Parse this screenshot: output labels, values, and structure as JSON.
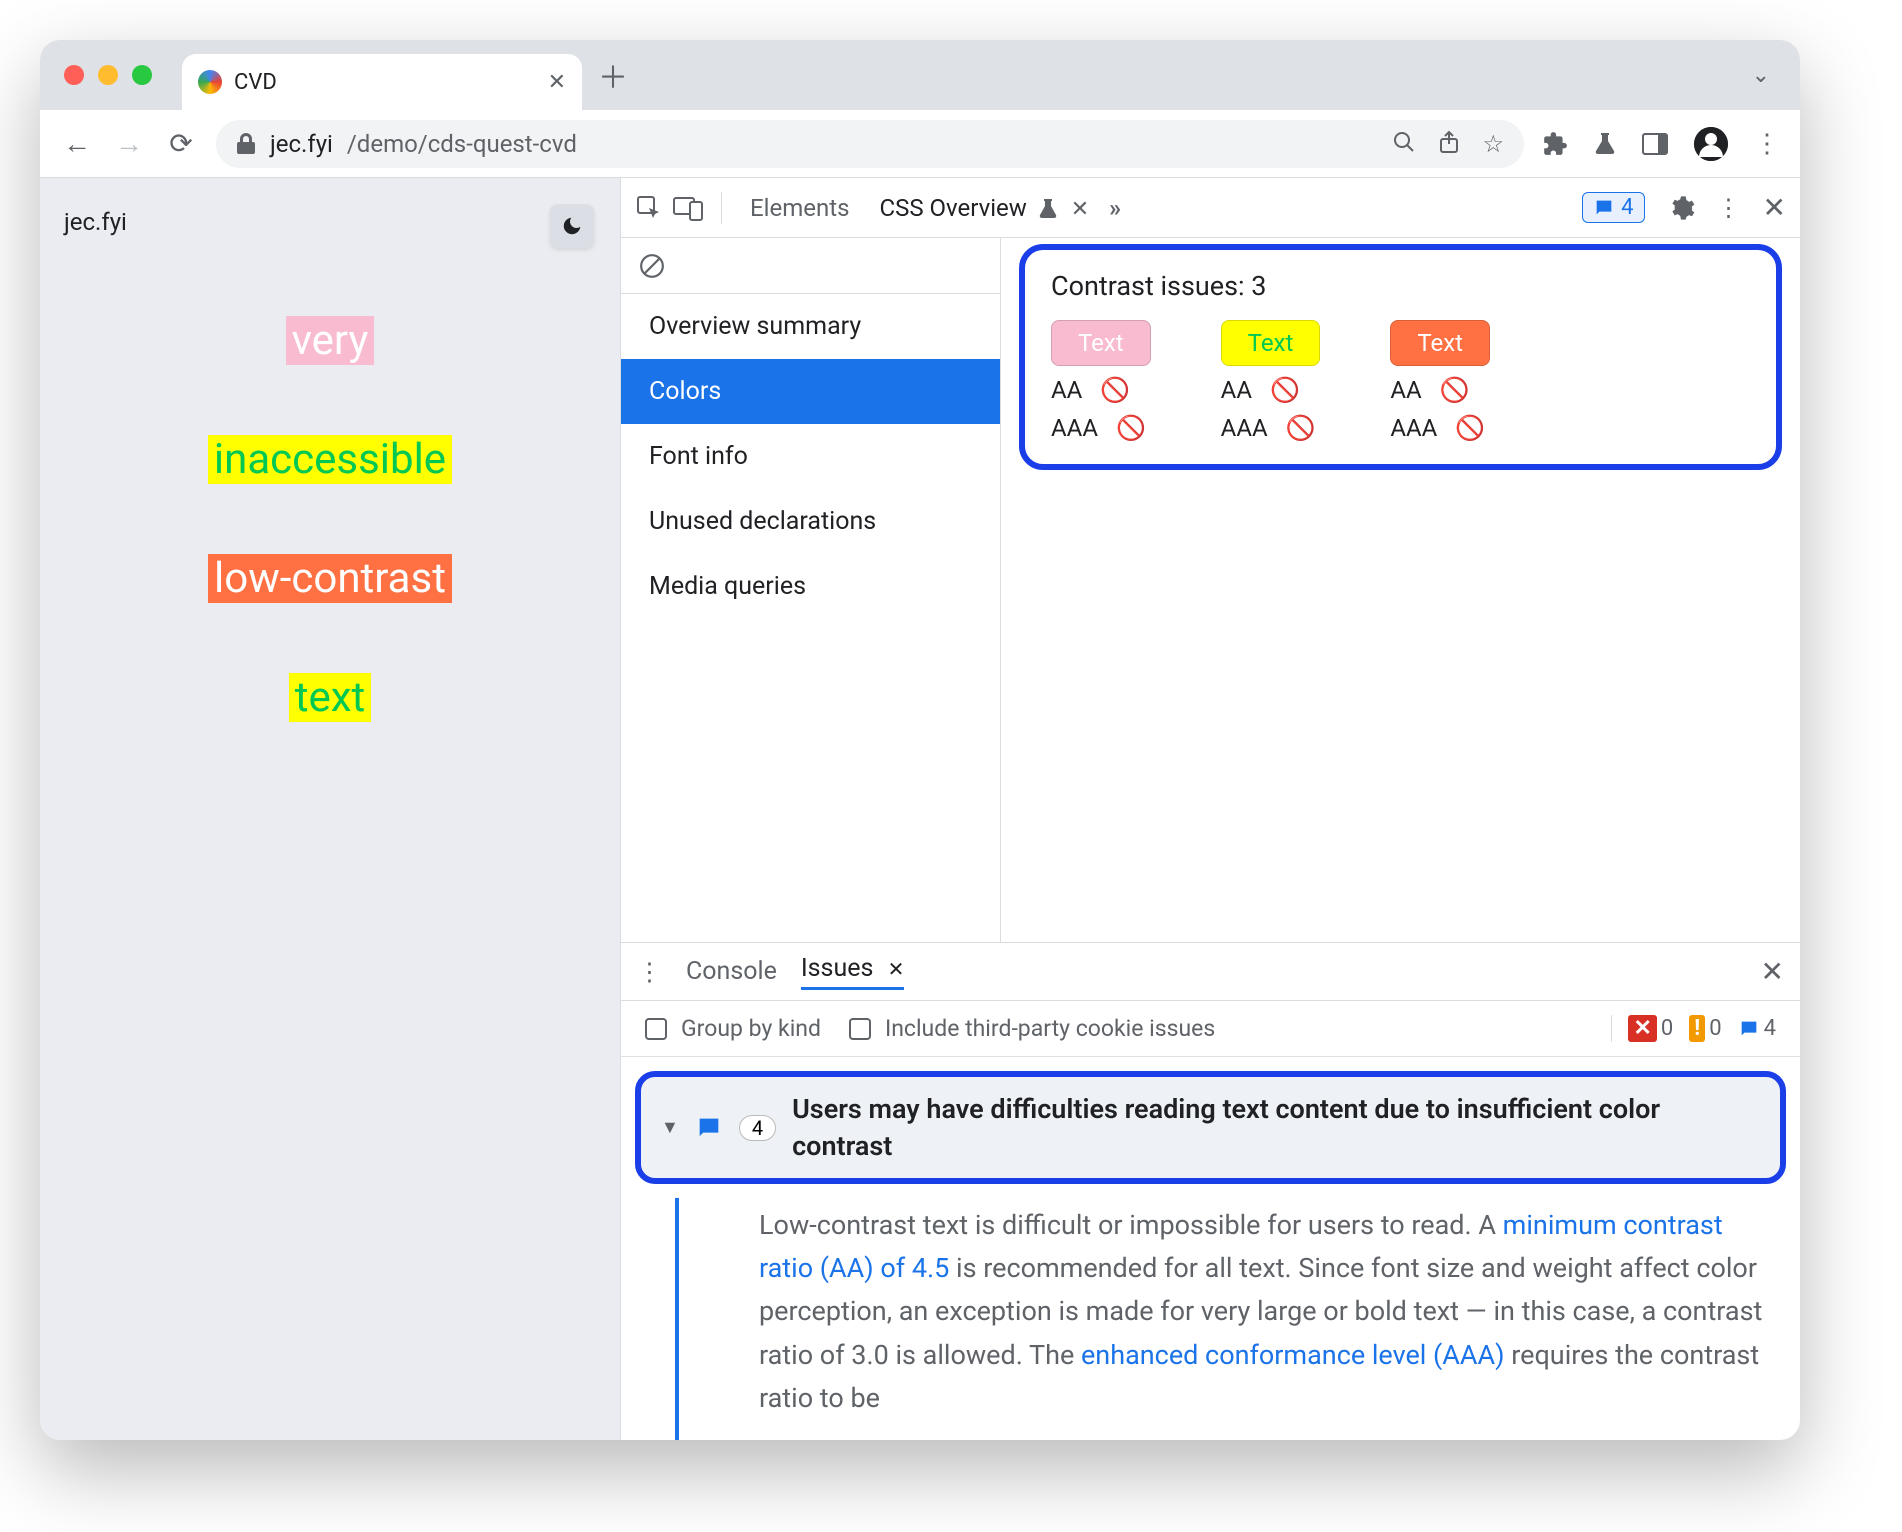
{
  "browser": {
    "tab_title": "CVD",
    "url_host": "jec.fyi",
    "url_path": "/demo/cds-quest-cvd"
  },
  "page": {
    "site_title": "jec.fyi",
    "samples": [
      "very",
      "inaccessible",
      "low-contrast",
      "text"
    ]
  },
  "devtools": {
    "tabs": {
      "elements": "Elements",
      "css_overview": "CSS Overview"
    },
    "issues_count": "4",
    "sidebar": {
      "items": [
        "Overview summary",
        "Colors",
        "Font info",
        "Unused declarations",
        "Media queries"
      ],
      "active_index": 1
    },
    "contrast": {
      "title": "Contrast issues: 3",
      "chips": [
        {
          "label": "Text",
          "class": "chip-pink"
        },
        {
          "label": "Text",
          "class": "chip-yellow"
        },
        {
          "label": "Text",
          "class": "chip-orange"
        }
      ],
      "aa": "AA",
      "aaa": "AAA"
    }
  },
  "drawer": {
    "tabs": {
      "console": "Console",
      "issues": "Issues"
    },
    "group_by_kind": "Group by kind",
    "include_third_party": "Include third-party cookie issues",
    "counts": {
      "errors": "0",
      "warnings": "0",
      "info": "4"
    },
    "issue_count_badge": "4",
    "issue_title": "Users may have difficulties reading text content due to insufficient color contrast",
    "body_1": "Low-contrast text is difficult or impossible for users to read. A ",
    "link_1": "minimum contrast ratio (AA) of 4.5",
    "body_2": " is recommended for all text. Since font size and weight affect color perception, an exception is made for very large or bold text — in this case, a contrast ratio of 3.0 is allowed. The ",
    "link_2": "enhanced conformance level (AAA)",
    "body_3": " requires the contrast ratio to be"
  }
}
